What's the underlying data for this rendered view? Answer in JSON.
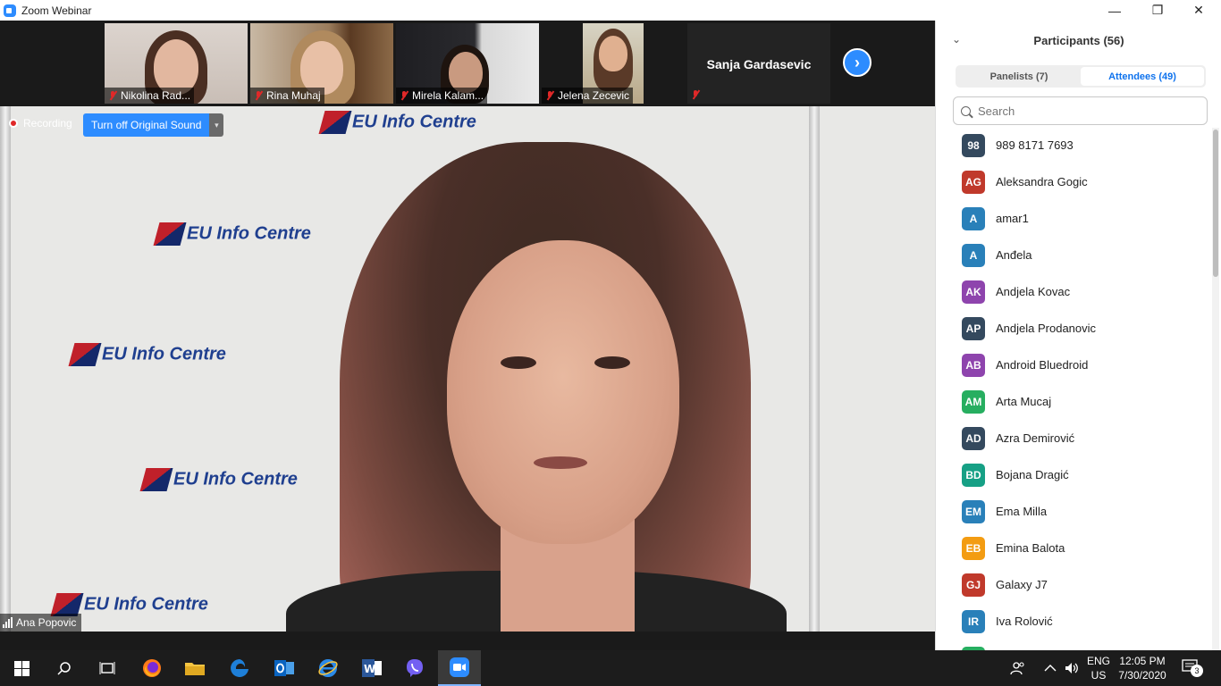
{
  "window": {
    "title": "Zoom Webinar",
    "minimize": "—",
    "maximize": "❐",
    "close": "✕"
  },
  "thumbnails": [
    {
      "name": "Nikolina Rad..."
    },
    {
      "name": "Rina Muhaj"
    },
    {
      "name": "Mirela Kalam..."
    },
    {
      "name": "Jelena Zecevic"
    }
  ],
  "name_tile": {
    "name": "Sanja Gardasevic"
  },
  "next_icon": "›",
  "recording": {
    "label": "Recording"
  },
  "original_sound": {
    "label": "Turn off Original Sound",
    "drop": "▾"
  },
  "backdrop": {
    "text": "EU Info Centre"
  },
  "speaker": {
    "name": "Ana Popovic"
  },
  "participants": {
    "title": "Participants (56)",
    "collapse_icon": "⌄",
    "tabs": [
      {
        "label": "Panelists (7)",
        "active": false
      },
      {
        "label": "Attendees (49)",
        "active": true
      }
    ],
    "search_placeholder": "Search",
    "list": [
      {
        "initials": "98",
        "name": "989 8171 7693",
        "color": "#34495e"
      },
      {
        "initials": "AG",
        "name": "Aleksandra Gogic",
        "color": "#c0392b"
      },
      {
        "initials": "A",
        "name": "amar1",
        "color": "#2980b9"
      },
      {
        "initials": "A",
        "name": "Anđela",
        "color": "#2980b9"
      },
      {
        "initials": "AK",
        "name": "Andjela Kovac",
        "color": "#8e44ad"
      },
      {
        "initials": "AP",
        "name": "Andjela Prodanovic",
        "color": "#34495e"
      },
      {
        "initials": "AB",
        "name": "Android Bluedroid",
        "color": "#8e44ad"
      },
      {
        "initials": "AM",
        "name": "Arta Mucaj",
        "color": "#27ae60"
      },
      {
        "initials": "AD",
        "name": "Azra Demirović",
        "color": "#34495e"
      },
      {
        "initials": "BD",
        "name": "Bojana Dragić",
        "color": "#16a085"
      },
      {
        "initials": "EM",
        "name": "Ema Milla",
        "color": "#2980b9"
      },
      {
        "initials": "EB",
        "name": "Emina Balota",
        "color": "#f39c12"
      },
      {
        "initials": "GJ",
        "name": "Galaxy J7",
        "color": "#c0392b"
      },
      {
        "initials": "IR",
        "name": "Iva Rolović",
        "color": "#2980b9"
      },
      {
        "initials": "",
        "name": "",
        "color": "#27ae60"
      }
    ]
  },
  "taskbar": {
    "language": "ENG",
    "region": "US",
    "time": "12:05 PM",
    "date": "7/30/2020",
    "notifications": "3"
  }
}
